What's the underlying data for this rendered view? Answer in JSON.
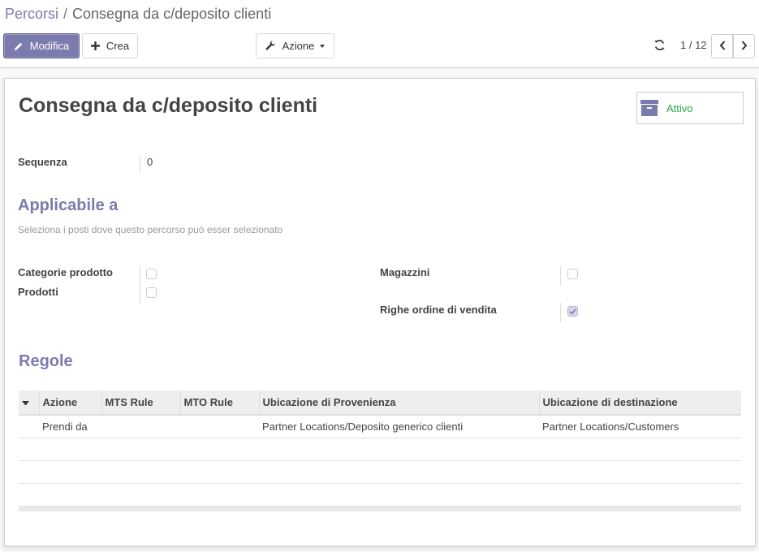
{
  "breadcrumb": {
    "parent": "Percorsi",
    "separator": "/",
    "current": "Consegna da c/deposito clienti"
  },
  "toolbar": {
    "edit_label": "Modifica",
    "create_label": "Crea",
    "action_label": "Azione",
    "pager_value": "1 / 12"
  },
  "record": {
    "title": "Consegna da c/deposito clienti",
    "active_label": "Attivo",
    "sequence_label": "Sequenza",
    "sequence_value": "0"
  },
  "applicable": {
    "title": "Applicabile a",
    "help": "Seleziona i posti dove questo percorso può esser selezionato",
    "fields": {
      "product_categories": {
        "label": "Categorie prodotto",
        "checked": false
      },
      "products": {
        "label": "Prodotti",
        "checked": false
      },
      "warehouses": {
        "label": "Magazzini",
        "checked": false
      },
      "sale_lines": {
        "label": "Righe ordine di vendita",
        "checked": true
      }
    }
  },
  "rules": {
    "title": "Regole",
    "columns": [
      "Azione",
      "MTS Rule",
      "MTO Rule",
      "Ubicazione di Provenienza",
      "Ubicazione di destinazione"
    ],
    "rows": [
      [
        "Prendi da",
        "",
        "",
        "Partner Locations/Deposito generico clienti",
        "Partner Locations/Customers"
      ]
    ]
  },
  "colors": {
    "primary": "#7c7bad",
    "active_green": "#28a745"
  }
}
